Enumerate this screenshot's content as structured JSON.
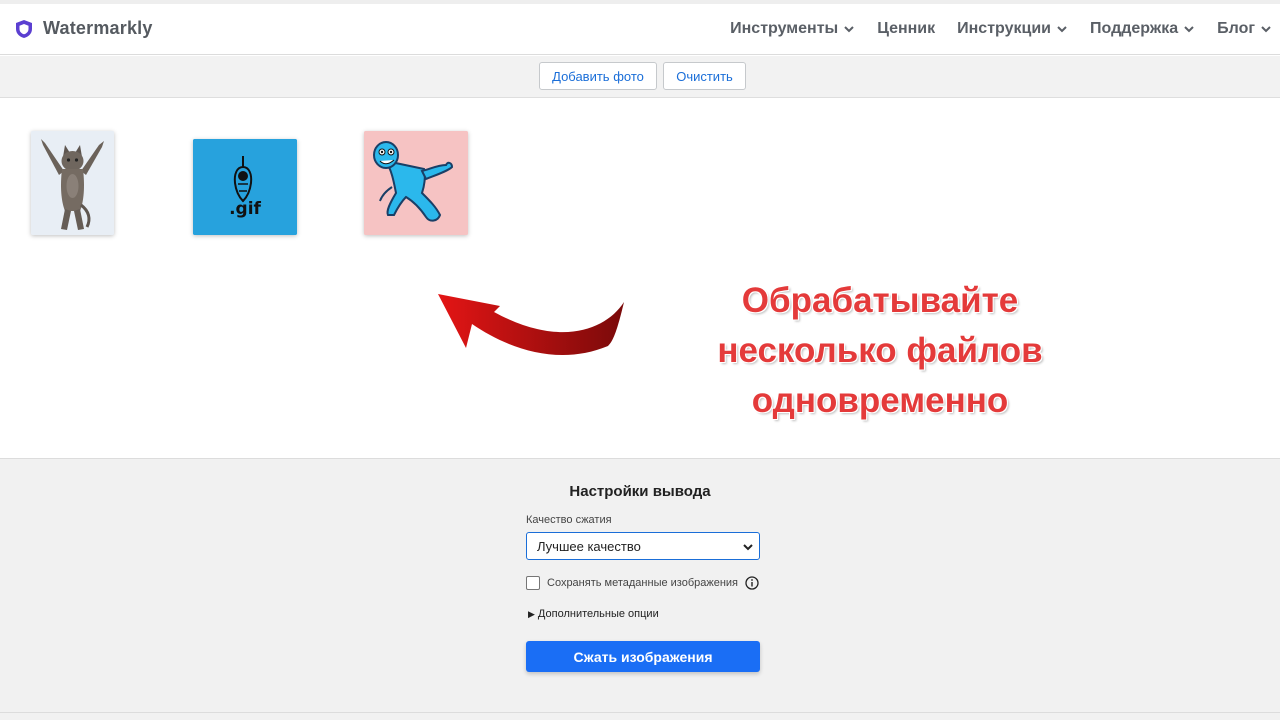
{
  "header": {
    "brand": "Watermarkly",
    "nav": [
      {
        "label": "Инструменты",
        "has_dropdown": true
      },
      {
        "label": "Ценник",
        "has_dropdown": false
      },
      {
        "label": "Инструкции",
        "has_dropdown": true
      },
      {
        "label": "Поддержка",
        "has_dropdown": true
      },
      {
        "label": "Блог",
        "has_dropdown": true
      }
    ]
  },
  "toolbar": {
    "add_photo_label": "Добавить фото",
    "clear_label": "Очистить"
  },
  "images": [
    {
      "name": "dancing-cat"
    },
    {
      "name": "gif-file",
      "caption": ".gif"
    },
    {
      "name": "blue-cartoon-character"
    }
  ],
  "promo": {
    "lines": [
      "Обрабатывайте",
      "несколько файлов",
      "одновременно"
    ],
    "color": "#e43a3a"
  },
  "settings": {
    "title": "Настройки вывода",
    "quality_label": "Качество сжатия",
    "quality_value": "Лучшее качество",
    "metadata_label": "Сохранять метаданные изображения",
    "metadata_checked": false,
    "advanced_label": "Дополнительные опции",
    "compress_label": "Сжать изображения"
  },
  "colors": {
    "accent": "#1a6ef5",
    "brand_icon": "#5b3fd1"
  }
}
